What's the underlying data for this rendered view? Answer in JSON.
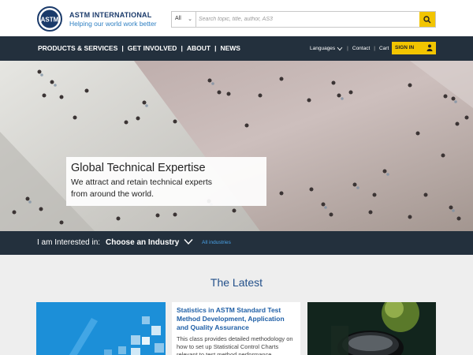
{
  "header": {
    "logo_mark": "ASTM",
    "logo_name": "ASTM INTERNATIONAL",
    "logo_tagline": "Helping our world work better",
    "search": {
      "category": "All",
      "placeholder": "Search topic, title, author, AS3"
    }
  },
  "nav": {
    "main_items": [
      "PRODUCTS & SERVICES",
      "GET INVOLVED",
      "ABOUT",
      "NEWS"
    ],
    "languages": "Languages",
    "contact": "Contact",
    "cart": "Cart",
    "signin": "SIGN IN"
  },
  "hero": {
    "title": "Global Technical Expertise",
    "subtitle_line1": "We attract and retain technical experts",
    "subtitle_line2": "from around the world."
  },
  "industry_bar": {
    "label": "I am Interested in:",
    "choose": "Choose an Industry",
    "all_link": "All industries"
  },
  "latest": {
    "title": "The Latest",
    "card": {
      "title": "Statistics in ASTM Standard Test Method Development, Application and Quality Assurance",
      "description": "This class provides detailed methodology on how to set up Statistical Control Charts relevant to test method performance"
    }
  },
  "colors": {
    "nav_bg": "#23303d",
    "accent_yellow": "#f2c500",
    "link_blue": "#1f5fa6",
    "tagline_blue": "#2e7fc2"
  }
}
